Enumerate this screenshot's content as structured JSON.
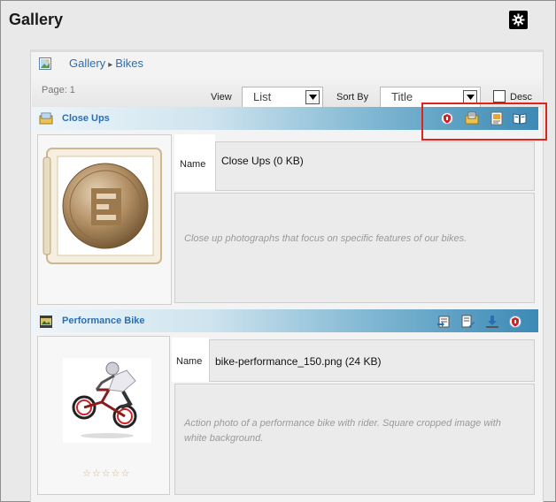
{
  "header": {
    "title": "Gallery",
    "settings_icon": "gear-icon"
  },
  "breadcrumb": {
    "items": [
      "Gallery",
      "Bikes"
    ],
    "separator": "▸",
    "icon": "gallery-picture-icon"
  },
  "toolbar": {
    "page_label": "Page: 1",
    "view_label": "View",
    "view_value": "List",
    "sort_label": "Sort By",
    "sort_value": "Title",
    "desc_label": "Desc",
    "desc_checked": false
  },
  "items": [
    {
      "title": "Close Ups",
      "type_icon": "album-folder-icon",
      "name_label": "Name",
      "name_value": "Close Ups (0 KB)",
      "description": "Close up photographs that focus on specific features of our bikes.",
      "actions": [
        "security-icon",
        "folder-edit-icon",
        "edit-properties-icon",
        "open-book-icon"
      ],
      "thumbnail": "album-coin-thumbnail",
      "highlighted": true
    },
    {
      "title": "Performance Bike",
      "type_icon": "image-file-icon",
      "name_label": "Name",
      "name_value": "bike-performance_150.png (24 KB)",
      "description": "Action photo of a performance bike with rider. Square cropped image with white background.",
      "actions": [
        "export-icon",
        "edit-document-icon",
        "download-icon",
        "security-icon"
      ],
      "thumbnail": "bike-rider-photo",
      "rating": "☆☆☆☆☆"
    }
  ],
  "colors": {
    "link": "#2a6fb3",
    "highlight": "#e0241a",
    "header_bar_end": "#3c8ab5"
  }
}
